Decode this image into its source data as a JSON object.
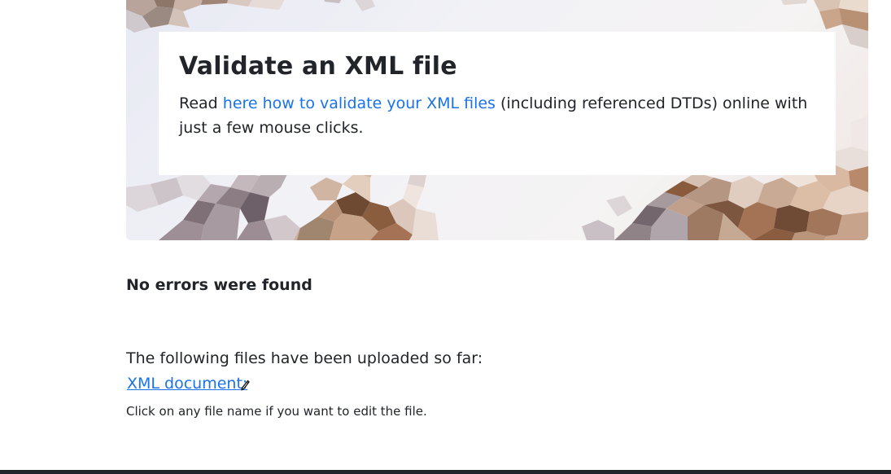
{
  "hero": {
    "title": "Validate an XML file",
    "text_before": "Read ",
    "link_text": "here how to validate your XML files",
    "text_after": " (including referenced DTDs) online with just a few mouse clicks."
  },
  "result": {
    "message": "No errors were found"
  },
  "uploads": {
    "intro": "The following files have been uploaded so far:",
    "files": [
      {
        "label": "XML document:",
        "icon": "pencil-icon"
      }
    ],
    "hint": "Click on any file name if you want to edit the file."
  },
  "colors": {
    "link": "#1a73e8",
    "text": "#212529",
    "footer": "#212529"
  }
}
